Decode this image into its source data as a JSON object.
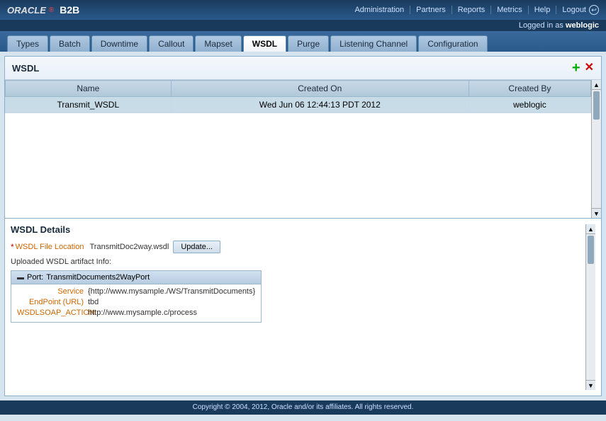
{
  "header": {
    "logo_oracle": "ORACLE",
    "logo_b2b": "B2B",
    "nav_items": [
      {
        "label": "Administration",
        "id": "administration"
      },
      {
        "label": "Partners",
        "id": "partners"
      },
      {
        "label": "Reports",
        "id": "reports"
      },
      {
        "label": "Metrics",
        "id": "metrics"
      },
      {
        "label": "Help",
        "id": "help"
      },
      {
        "label": "Logout",
        "id": "logout"
      }
    ],
    "logged_in_text": "Logged in as ",
    "username": "weblogic"
  },
  "tabs": [
    {
      "label": "Types",
      "id": "types",
      "active": false
    },
    {
      "label": "Batch",
      "id": "batch",
      "active": false
    },
    {
      "label": "Downtime",
      "id": "downtime",
      "active": false
    },
    {
      "label": "Callout",
      "id": "callout",
      "active": false
    },
    {
      "label": "Mapset",
      "id": "mapset",
      "active": false
    },
    {
      "label": "WSDL",
      "id": "wsdl",
      "active": true
    },
    {
      "label": "Purge",
      "id": "purge",
      "active": false
    },
    {
      "label": "Listening Channel",
      "id": "listening-channel",
      "active": false
    },
    {
      "label": "Configuration",
      "id": "configuration",
      "active": false
    }
  ],
  "panel": {
    "title": "WSDL",
    "add_icon": "+",
    "delete_icon": "✕",
    "table": {
      "columns": [
        "Name",
        "Created On",
        "Created By"
      ],
      "rows": [
        {
          "name": "Transmit_WSDL",
          "created_on": "Wed Jun 06 12:44:13 PDT 2012",
          "created_by": "weblogic",
          "selected": true
        }
      ]
    }
  },
  "details": {
    "section_title": "WSDL Details",
    "wsdl_file_label": "WSDL File Location",
    "wsdl_file_value": "TransmitDoc2way.wsdl",
    "update_button": "Update...",
    "artifact_label": "Uploaded WSDL artifact Info:",
    "port": {
      "name": "TransmitDocuments2WayPort",
      "fields": [
        {
          "label": "Service",
          "value": "{http://www.mysample./WS/TransmitDocuments}"
        },
        {
          "label": "EndPoint (URL)",
          "value": "tbd"
        },
        {
          "label": "WSDLSOAP_ACTION",
          "value": "http://www.mysample.c/process"
        }
      ]
    }
  },
  "footer": {
    "text": "Copyright © 2004, 2012, Oracle and/or its affiliates. All rights reserved."
  }
}
